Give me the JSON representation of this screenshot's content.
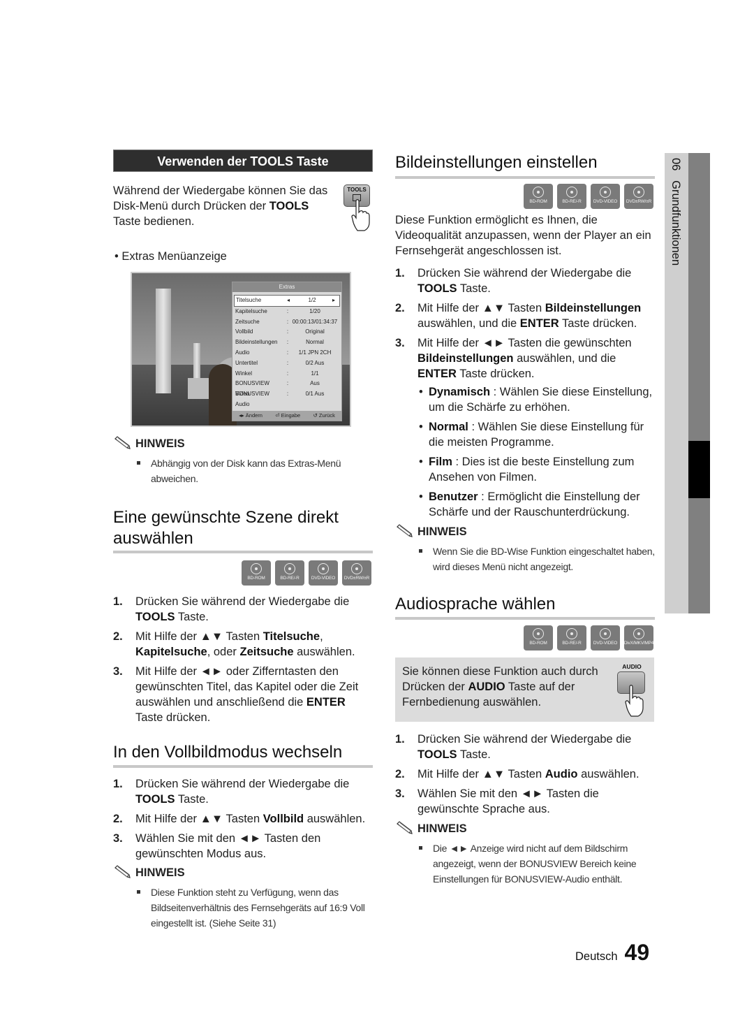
{
  "side_tab": {
    "chapter_number": "06",
    "chapter_title": "Grundfunktionen"
  },
  "tools_section": {
    "header": "Verwenden der TOOLS Taste",
    "intro_parts": [
      "Während der Wiedergabe können Sie das Disk-Menü durch Drücken der ",
      "TOOLS",
      " Taste bedienen."
    ],
    "remote_button_label": "TOOLS",
    "bullet": "Extras Menüanzeige",
    "extras_menu": {
      "title": "Extras",
      "rows": [
        {
          "key": "Titelsuche",
          "sep": "◂",
          "value": "1/2",
          "arrow": "▸",
          "selected": true
        },
        {
          "key": "Kapitelsuche",
          "sep": ":",
          "value": "1/20"
        },
        {
          "key": "Zeitsuche",
          "sep": ":",
          "value": "00:00:13/01:34:37"
        },
        {
          "key": "Vollbild",
          "sep": ":",
          "value": "Original"
        },
        {
          "key": "Bildeinstellungen",
          "sep": ":",
          "value": "Normal"
        },
        {
          "key": "Audio",
          "sep": ":",
          "value": "1/1 JPN 2CH"
        },
        {
          "key": "Untertitel",
          "sep": ":",
          "value": "0/2 Aus"
        },
        {
          "key": "Winkel",
          "sep": ":",
          "value": "1/1"
        },
        {
          "key": "BONUSVIEW Video",
          "sep": ":",
          "value": "Aus"
        },
        {
          "key": "BONUSVIEW Audio",
          "sep": ":",
          "value": "0/1 Aus"
        }
      ],
      "footer": {
        "change": "◂▸ Ändern",
        "enter": "⏎ Eingabe",
        "back": "↺ Zurück"
      }
    },
    "note_title": "HINWEIS",
    "note_text": "Abhängig von der Disk kann das Extras-Menü abweichen."
  },
  "scene_section": {
    "title": "Eine gewünschte Szene direkt auswählen",
    "discs": [
      "BD-ROM",
      "BD-RE/-R",
      "DVD-VIDEO",
      "DVD±RW/±R"
    ],
    "steps": [
      {
        "num": "1.",
        "parts": [
          {
            "t": "Drücken Sie während der Wiedergabe die "
          },
          {
            "t": "TOOLS",
            "b": true
          },
          {
            "t": " Taste."
          }
        ]
      },
      {
        "num": "2.",
        "parts": [
          {
            "t": "Mit Hilfe der ▲▼ Tasten "
          },
          {
            "t": "Titelsuche",
            "b": true
          },
          {
            "t": ", "
          },
          {
            "t": "Kapitelsuche",
            "b": true
          },
          {
            "t": ", oder "
          },
          {
            "t": "Zeitsuche",
            "b": true
          },
          {
            "t": " auswählen."
          }
        ]
      },
      {
        "num": "3.",
        "parts": [
          {
            "t": "Mit Hilfe der ◄► oder Zifferntasten den gewünschten Titel, das Kapitel oder die Zeit auswählen und anschließend die "
          },
          {
            "t": "ENTER",
            "b": true
          },
          {
            "t": " Taste drücken."
          }
        ]
      }
    ]
  },
  "fullscreen_section": {
    "title": "In den Vollbildmodus wechseln",
    "steps": [
      {
        "num": "1.",
        "parts": [
          {
            "t": "Drücken Sie während der Wiedergabe die "
          },
          {
            "t": "TOOLS",
            "b": true
          },
          {
            "t": " Taste."
          }
        ]
      },
      {
        "num": "2.",
        "parts": [
          {
            "t": "Mit Hilfe der ▲▼ Tasten "
          },
          {
            "t": "Vollbild",
            "b": true
          },
          {
            "t": " auswählen."
          }
        ]
      },
      {
        "num": "3.",
        "parts": [
          {
            "t": "Wählen Sie mit den ◄► Tasten den gewünschten Modus aus."
          }
        ]
      }
    ],
    "note_title": "HINWEIS",
    "note_text": "Diese Funktion steht zu Verfügung, wenn das Bildseitenverhältnis des Fernsehgeräts auf 16:9 Voll eingestellt ist. (Siehe Seite 31)"
  },
  "picture_section": {
    "title": "Bildeinstellungen einstellen",
    "discs": [
      "BD-ROM",
      "BD-RE/-R",
      "DVD-VIDEO",
      "DVD±RW/±R"
    ],
    "intro": "Diese Funktion ermöglicht es Ihnen, die Videoqualität anzupassen, wenn der Player an ein Fernsehgerät angeschlossen ist.",
    "steps": [
      {
        "num": "1.",
        "parts": [
          {
            "t": "Drücken Sie während der Wiedergabe die "
          },
          {
            "t": "TOOLS",
            "b": true
          },
          {
            "t": " Taste."
          }
        ]
      },
      {
        "num": "2.",
        "parts": [
          {
            "t": "Mit Hilfe der ▲▼ Tasten "
          },
          {
            "t": "Bildeinstellungen",
            "b": true
          },
          {
            "t": " auswählen, und die "
          },
          {
            "t": "ENTER",
            "b": true
          },
          {
            "t": " Taste drücken."
          }
        ]
      },
      {
        "num": "3.",
        "parts": [
          {
            "t": "Mit Hilfe der ◄► Tasten die gewünschten "
          },
          {
            "t": "Bildeinstellungen",
            "b": true
          },
          {
            "t": " auswählen, und die "
          },
          {
            "t": "ENTER",
            "b": true
          },
          {
            "t": " Taste drücken."
          }
        ]
      }
    ],
    "options": [
      {
        "name": "Dynamisch",
        "desc": " : Wählen Sie diese Einstellung, um die Schärfe zu erhöhen."
      },
      {
        "name": "Normal",
        "desc": " : Wählen Sie diese Einstellung für die meisten Programme."
      },
      {
        "name": "Film",
        "desc": " : Dies ist die beste Einstellung zum Ansehen von Filmen."
      },
      {
        "name": "Benutzer",
        "desc": " : Ermöglicht die Einstellung der Schärfe und der Rauschunterdrückung."
      }
    ],
    "note_title": "HINWEIS",
    "note_text": "Wenn Sie die BD-Wise Funktion eingeschaltet haben, wird dieses Menü nicht angezeigt."
  },
  "audio_section": {
    "title": "Audiosprache wählen",
    "discs": [
      "BD-ROM",
      "BD-RE/-R",
      "DVD-VIDEO",
      "DivX/MKV/MP4"
    ],
    "tip_parts": [
      "Sie können diese Funktion auch durch Drücken der ",
      "AUDIO",
      " Taste auf der Fernbedienung auswählen."
    ],
    "remote_button_label": "AUDIO",
    "steps": [
      {
        "num": "1.",
        "parts": [
          {
            "t": "Drücken Sie während der Wiedergabe die "
          },
          {
            "t": "TOOLS",
            "b": true
          },
          {
            "t": " Taste."
          }
        ]
      },
      {
        "num": "2.",
        "parts": [
          {
            "t": "Mit Hilfe der ▲▼ Tasten "
          },
          {
            "t": "Audio",
            "b": true
          },
          {
            "t": " auswählen."
          }
        ]
      },
      {
        "num": "3.",
        "parts": [
          {
            "t": "Wählen Sie mit den ◄► Tasten die gewünschte Sprache aus."
          }
        ]
      }
    ],
    "note_title": "HINWEIS",
    "note_text": "Die ◄► Anzeige wird nicht auf dem Bildschirm angezeigt, wenn der BONUSVIEW Bereich keine Einstellungen für BONUSVIEW-Audio enthält."
  },
  "footer": {
    "language": "Deutsch",
    "page_number": "49"
  }
}
